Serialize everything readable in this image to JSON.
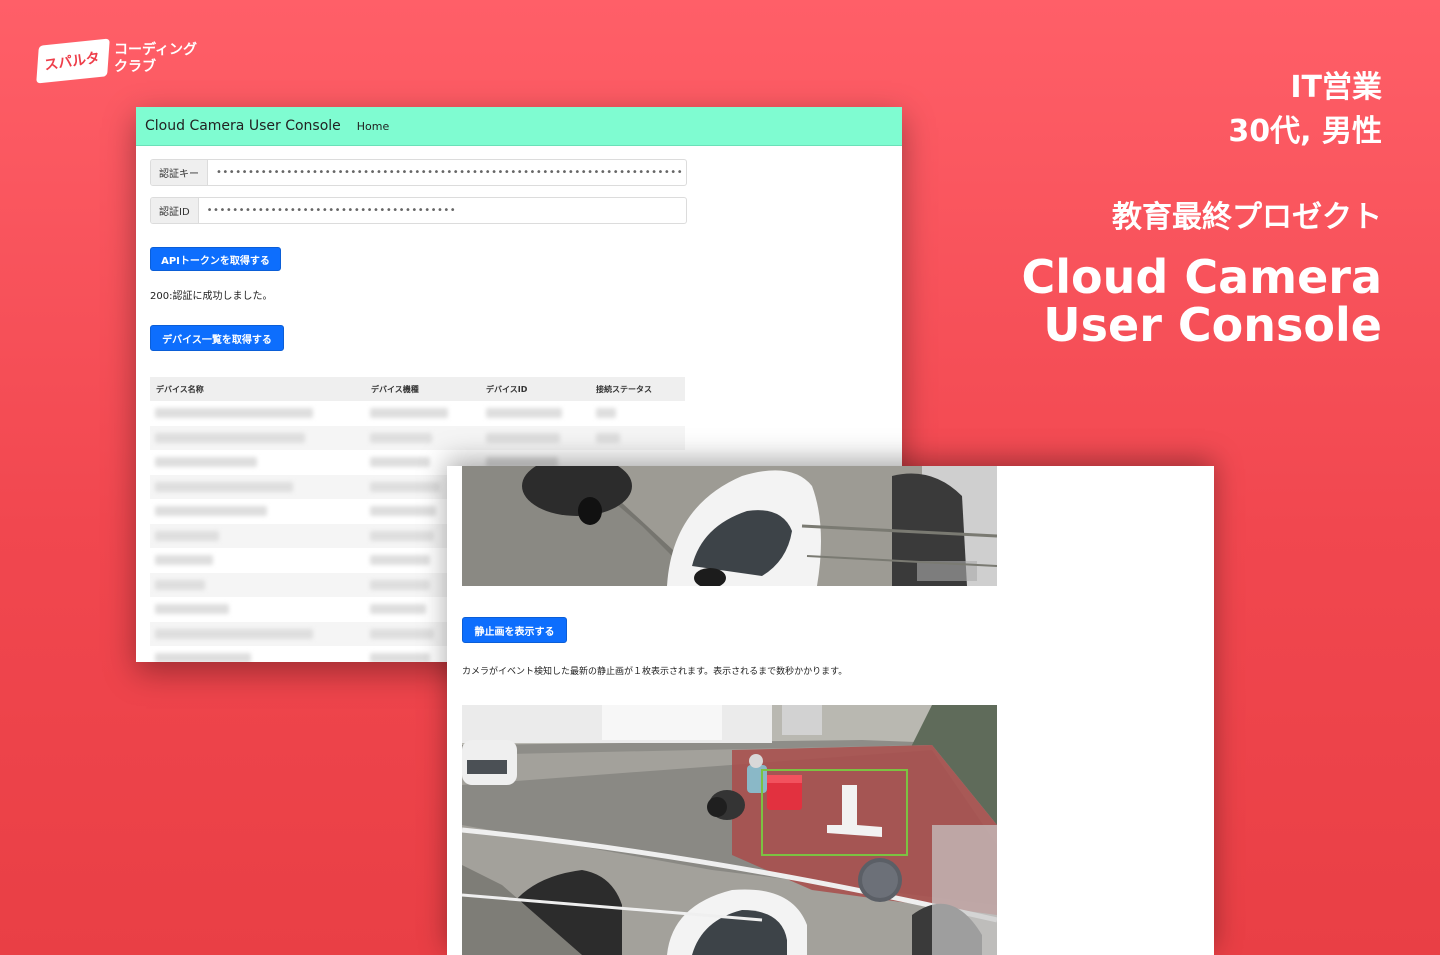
{
  "logo": {
    "badge": "スパルタ",
    "sub_line1": "コーディング",
    "sub_line2": "クラブ"
  },
  "headline": {
    "role_line1": "IT営業",
    "role_line2": "30代, 男性",
    "education_label": "教育最終プロゼクト",
    "project_line1": "Cloud Camera",
    "project_line2": "User Console"
  },
  "console": {
    "navbar": {
      "brand": "Cloud Camera User Console",
      "home_link": "Home",
      "color": "#7ffcd1"
    },
    "auth_key": {
      "label": "認証キー",
      "value": "•••••••••••••••••••••••••••••••••••••••••••••••••••••••••••••••••••••••••"
    },
    "auth_id": {
      "label": "認証ID",
      "value": "•••••••••••••••••••••••••••••••••••••••"
    },
    "get_token_button": "APIトークンを取得する",
    "status_message": "200:認証に成功しました。",
    "get_devices_button": "デバイス一覧を取得する",
    "table": {
      "headers": [
        "デバイス名称",
        "デバイス機種",
        "デバイスID",
        "接続ステータス"
      ]
    }
  },
  "viewer": {
    "show_still_button": "静止画を表示する",
    "description": "カメラがイベント検知した最新の静止画が１枚表示されます。表示されるまで数秒かかります。"
  },
  "colors": {
    "background": "#f1474f",
    "primary_button": "#0d6efd",
    "navbar": "#7ffcd1",
    "detection_box": "#7cc242"
  }
}
